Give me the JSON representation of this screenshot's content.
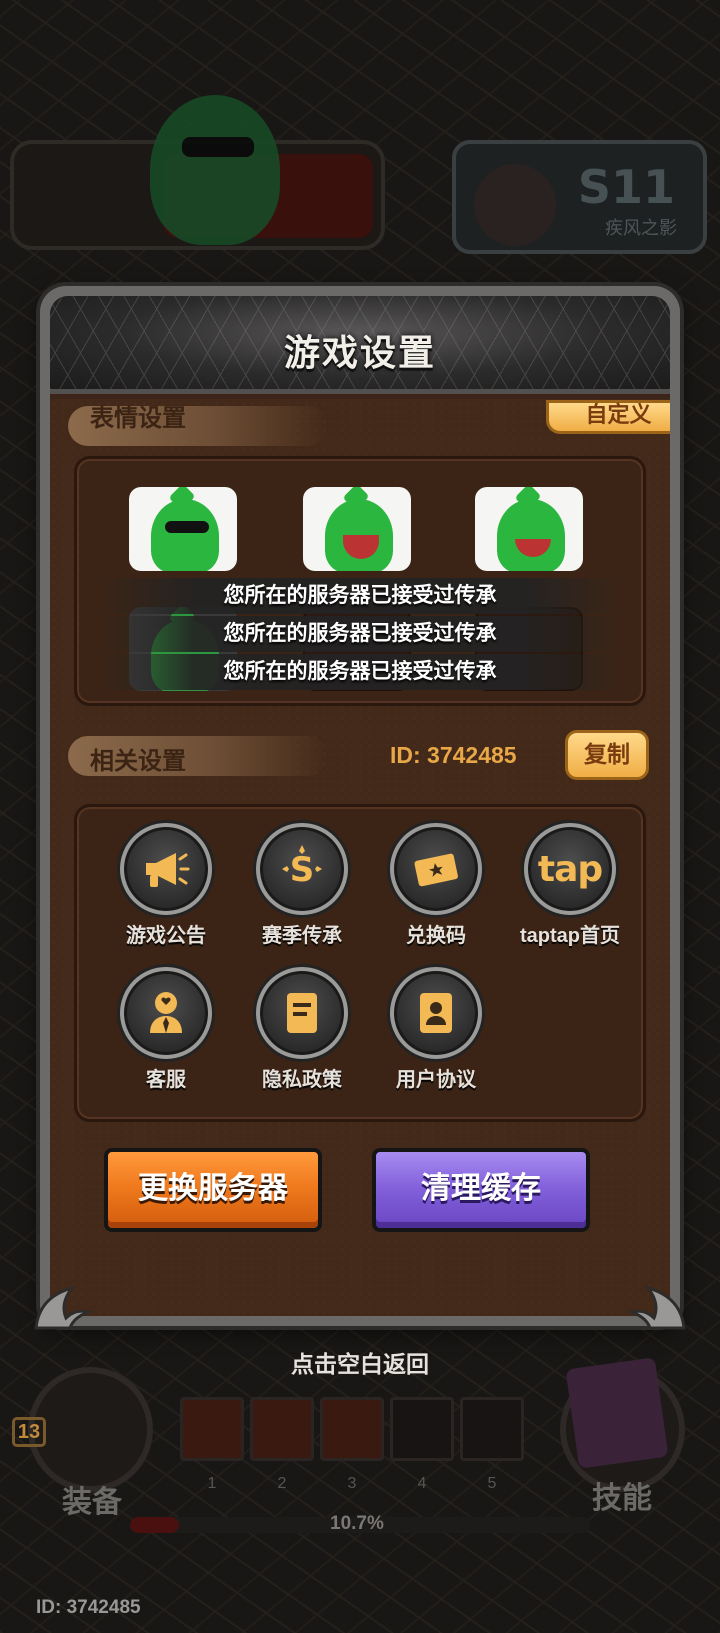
{
  "background": {
    "season_badge": "S11",
    "season_subtitle": "疾风之影",
    "equip_label": "装备",
    "skill_label": "技能",
    "level_badge": "13",
    "slot_numbers": [
      "1",
      "2",
      "3",
      "4",
      "5"
    ],
    "progress": 0.107,
    "progress_text": "10.7%",
    "footer_id": "ID: 3742485"
  },
  "panel": {
    "title": "游戏设置",
    "emote_section": {
      "label": "表情设置",
      "custom_button": "自定义"
    },
    "toasts": [
      "您所在的服务器已接受过传承",
      "您所在的服务器已接受过传承",
      "您所在的服务器已接受过传承"
    ],
    "related_section": {
      "label": "相关设置",
      "id_text": "ID: 3742485",
      "copy_button": "复制"
    },
    "items": [
      {
        "label": "游戏公告",
        "icon": "megaphone-icon"
      },
      {
        "label": "赛季传承",
        "icon": "season-s-icon"
      },
      {
        "label": "兑换码",
        "icon": "ticket-icon"
      },
      {
        "label": "taptap首页",
        "icon": "taptap-icon",
        "glyph": "tap"
      },
      {
        "label": "客服",
        "icon": "customer-service-icon"
      },
      {
        "label": "隐私政策",
        "icon": "document-icon"
      },
      {
        "label": "用户协议",
        "icon": "id-card-icon"
      }
    ],
    "change_server_button": "更换服务器",
    "clear_cache_button": "清理缓存"
  },
  "back_hint": "点击空白返回",
  "colors": {
    "gold": "#f0ae45",
    "orange_button": "#f07a1e",
    "purple_button": "#8462dc",
    "panel_brown": "#432919"
  }
}
